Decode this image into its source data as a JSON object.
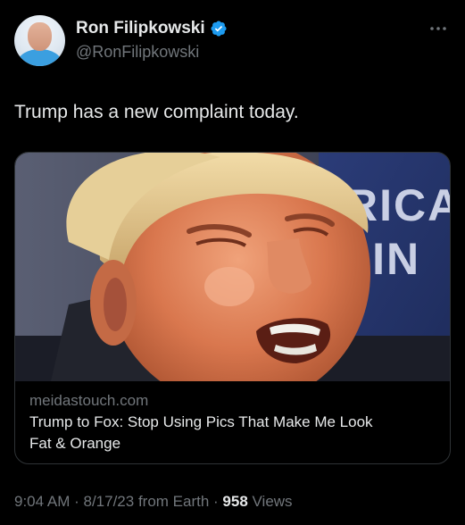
{
  "author": {
    "display_name": "Ron Filipkowski",
    "handle": "@RonFilipkowski",
    "verified_icon": "verified-badge-icon",
    "verified_color": "#1d9bf0"
  },
  "tweet": {
    "text": "Trump has a new complaint today."
  },
  "card": {
    "image_text": "RICA\nAIN",
    "domain": "meidastouch.com",
    "title_line1": "Trump to Fox: Stop Using Pics That Make Me Look",
    "title_line2": "Fat & Orange"
  },
  "footer": {
    "time": "9:04 AM",
    "sep1": " · ",
    "date": "8/17/23",
    "source": " from Earth",
    "sep2": " · ",
    "views_count": "958",
    "views_label": " Views"
  },
  "colors": {
    "background": "#000000",
    "text_primary": "#e7e9ea",
    "text_secondary": "#71767b",
    "border": "#2f3336"
  }
}
